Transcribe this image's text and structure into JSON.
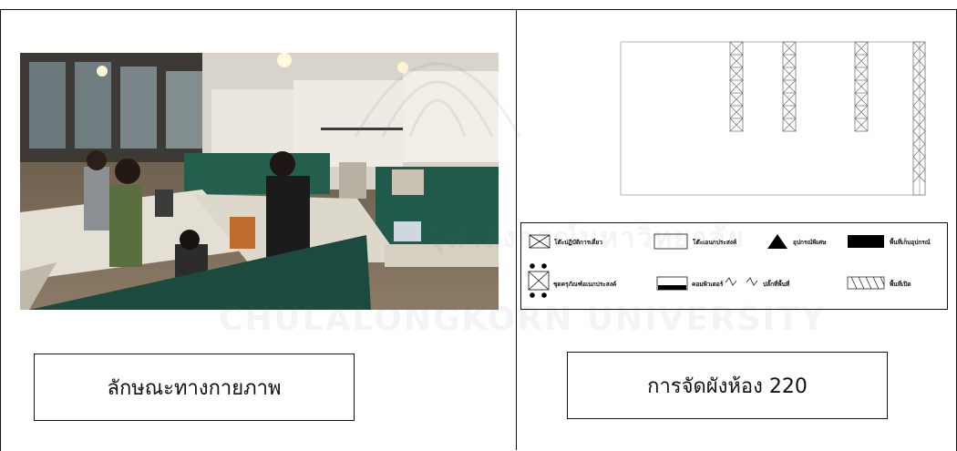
{
  "captions": {
    "left": "ลักษณะทางกายภาพ",
    "right": "การจัดผังห้อง 220"
  },
  "legend": {
    "single_desk": "โต๊ะปฏิบัติการเดี่ยว",
    "multi_desk": "โต๊ะเอนกประสงค์",
    "special_equipment": "อุปกรณ์พิเศษ",
    "equipment_storage": "พื้นที่เก็บอุปกรณ์",
    "multi_purpose_set": "ชุดครุภัณฑ์อเนกประสงค์",
    "computer": "คอมพิวเตอร์",
    "floor_outlet": "ปลั๊กที่พื้นที่",
    "open_area": "พื้นที่เปิด"
  },
  "watermark": {
    "line1": "จุฬาลงกรณ์มหาวิทยาลัย",
    "line2": "CHULALONGKORN UNIVERSITY"
  },
  "colors": {
    "border": "#111111",
    "photo_wall": "#e8e4dc",
    "partition_green": "#1f5a4a"
  }
}
